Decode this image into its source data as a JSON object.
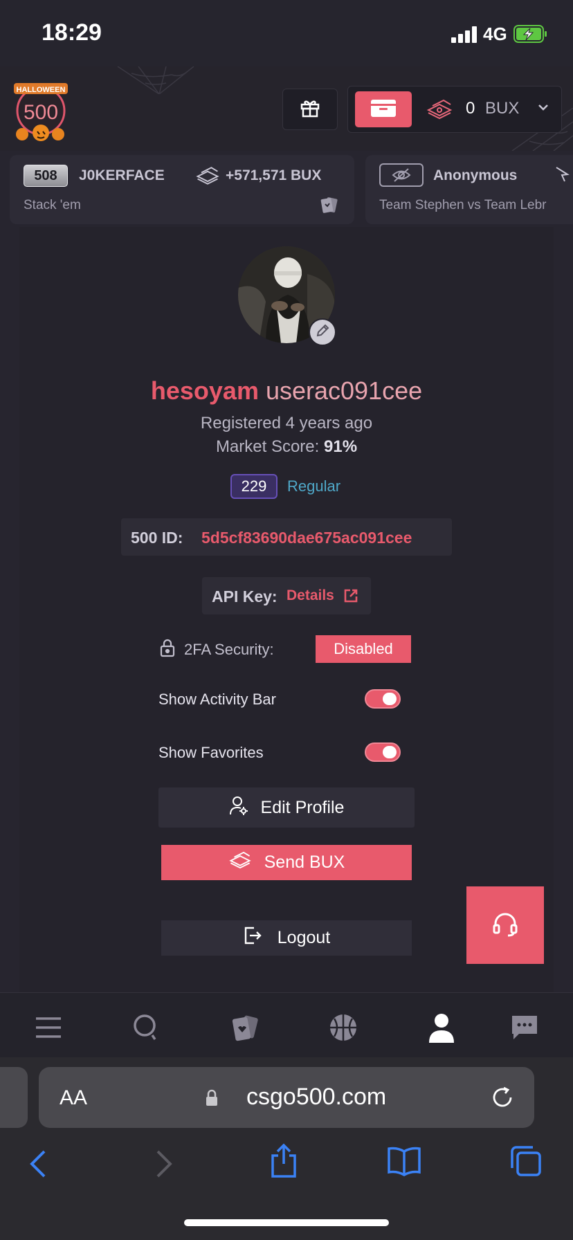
{
  "status_bar": {
    "time": "18:29",
    "network": "4G"
  },
  "header": {
    "logo_text": "500",
    "logo_banner": "HALLOWEEN",
    "wallet": {
      "amount": "0",
      "unit": "BUX"
    }
  },
  "activity": [
    {
      "level": "508",
      "name": "J0KERFACE",
      "amount": "+571,571 BUX",
      "game": "Stack 'em"
    },
    {
      "name": "Anonymous",
      "game": "Team Stephen vs Team Lebr"
    }
  ],
  "profile": {
    "display_name": "hesoyam",
    "username": "userac091cee",
    "registered": "Registered 4 years ago",
    "market_score_label": "Market Score:",
    "market_score_value": "91%",
    "level": "229",
    "rank": "Regular",
    "id_label": "500 ID:",
    "id_value": "5d5cf83690dae675ac091cee",
    "api_label": "API Key:",
    "api_link": "Details",
    "twofa_label": "2FA Security:",
    "twofa_status": "Disabled",
    "show_activity_label": "Show Activity Bar",
    "show_activity_on": true,
    "show_favorites_label": "Show Favorites",
    "show_favorites_on": true,
    "edit_profile": "Edit Profile",
    "send_bux": "Send BUX",
    "logout": "Logout"
  },
  "bottom_nav": [
    "menu-icon",
    "search-icon",
    "cards-icon",
    "basketball-icon",
    "profile-icon",
    "chat-icon"
  ],
  "browser": {
    "text_size": "AA",
    "domain": "csgo500.com"
  },
  "colors": {
    "accent": "#e85a6c",
    "background": "#25232c",
    "rank": "#4fa8c9"
  }
}
